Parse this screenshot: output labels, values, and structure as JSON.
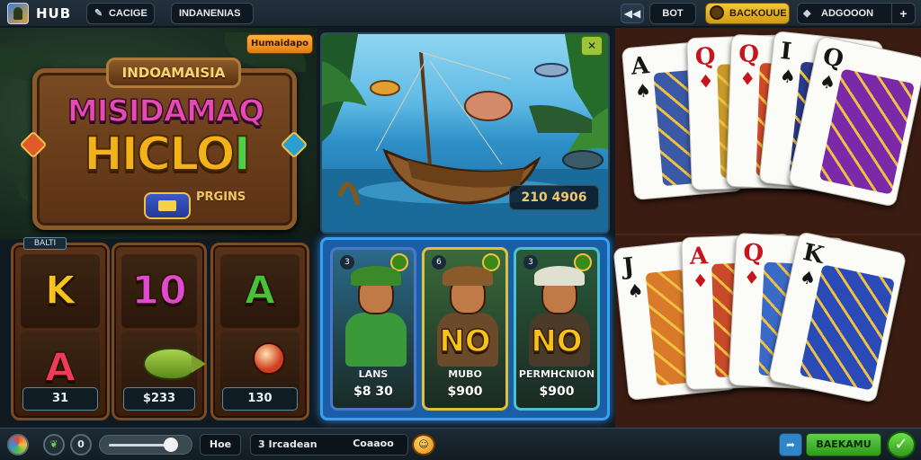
{
  "topbar": {
    "hub_label": "HUB",
    "pill1_icon": "brush-icon",
    "pill1_label": "CACIGE",
    "pill2_label": "INDANENIAS",
    "back_icon": "rewind-icon",
    "bet_label": "BOT",
    "coin_label": "BACKOUUE",
    "diamond_icon": "diamond-icon",
    "account_label": "ADGOOON",
    "plus_label": "+"
  },
  "title_board": {
    "top_label": "INDOAMAISIA",
    "line1": "MISIDAMAQ",
    "line2_a": "HICLO",
    "line2_b": "I",
    "sub_label": "PRGINS"
  },
  "promo": {
    "badge_label": "Humaidapo",
    "close_icon": "close-icon",
    "amount_label": "210 4906"
  },
  "reels": {
    "tag_label": "BALTI",
    "items": [
      {
        "top_symbol": "K",
        "top_color": "#f6c21c",
        "bottom_symbol": "A",
        "bottom_color": "#ef3a5a",
        "value": "31"
      },
      {
        "top_symbol": "10",
        "top_color": "#e04ad0",
        "bottom_symbol": "fish-icon",
        "bottom_color": "#8ac23a",
        "value": "$233"
      },
      {
        "top_symbol": "A",
        "top_color": "#46c23a",
        "bottom_symbol": "mascot-icon",
        "bottom_color": "#d04020",
        "value": "130"
      }
    ]
  },
  "characters": [
    {
      "num": "3",
      "big": "",
      "name": "LANS",
      "price": "$8 30",
      "border": "#4a78c8",
      "bg": "#2a6a8a",
      "hat": "#3a8a2a",
      "body": "#3a9a3a"
    },
    {
      "num": "6",
      "big": "NO",
      "name": "MUBO",
      "price": "$900",
      "border": "#e0c03a",
      "bg": "#3a6a3a",
      "hat": "#8a5a2a",
      "body": "#6a4a2a"
    },
    {
      "num": "3",
      "big": "NO",
      "name": "PERMHCNION",
      "price": "$900",
      "border": "#4ac0d0",
      "bg": "#2a5a3a",
      "hat": "#e0e0d0",
      "body": "#4a3a2a"
    }
  ],
  "cards": [
    {
      "rank": "A",
      "suit": "♠",
      "color": "blk"
    },
    {
      "rank": "Q",
      "suit": "♦",
      "color": "red"
    },
    {
      "rank": "Q",
      "suit": "♦",
      "color": "red"
    },
    {
      "rank": "I",
      "suit": "♠",
      "color": "blk"
    },
    {
      "rank": "Q",
      "suit": "♠",
      "color": "blk"
    },
    {
      "rank": "J",
      "suit": "♠",
      "color": "blk"
    },
    {
      "rank": "A",
      "suit": "♦",
      "color": "red"
    },
    {
      "rank": "Q",
      "suit": "♦",
      "color": "red"
    },
    {
      "rank": "K",
      "suit": "♠",
      "color": "blk"
    }
  ],
  "bottombar": {
    "wheel_icon": "spin-wheel-icon",
    "leaf_icon": "leaf-icon",
    "zero_label": "0",
    "slider_value": 0.82,
    "hoe_label": "Hoe",
    "input_label": "3 Ircadean",
    "coin_value_label": "Coaaoo",
    "coin_icon": "smile-coin-icon",
    "share_icon": "share-icon",
    "bet_button_label": "BAEKAMU",
    "confirm_icon": "check-icon"
  }
}
